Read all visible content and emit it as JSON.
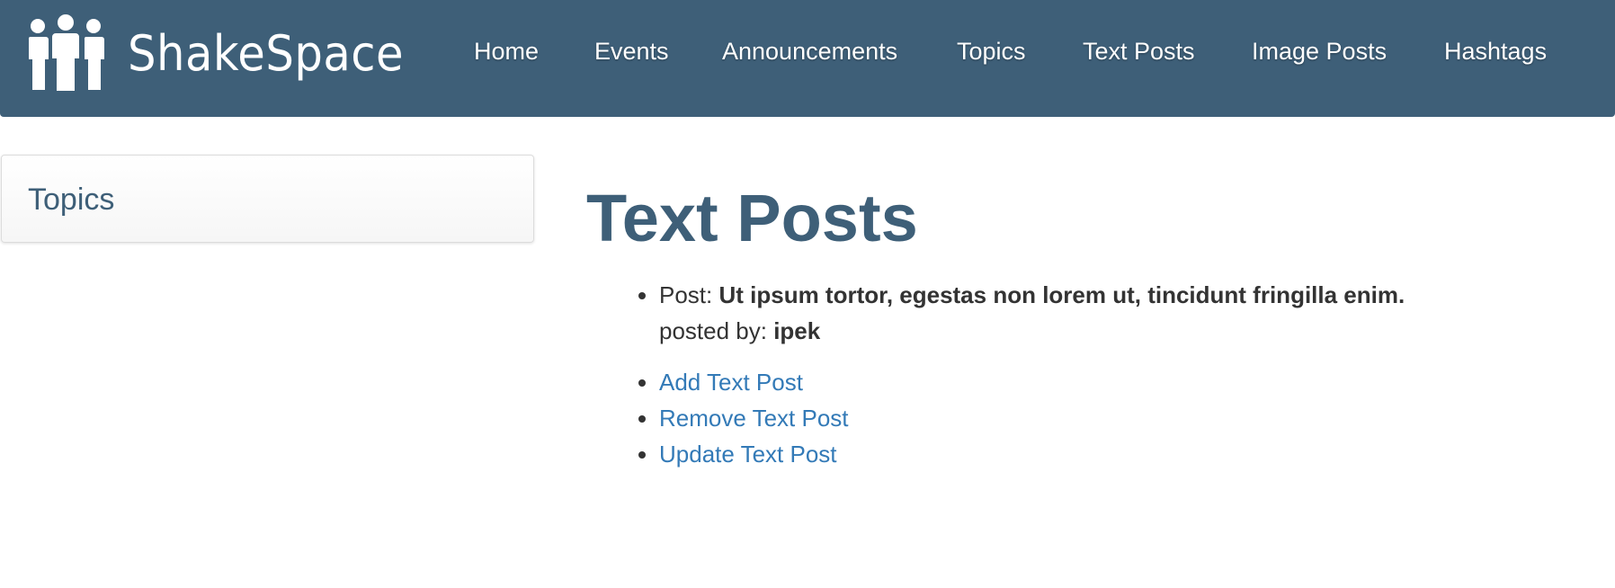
{
  "brand": {
    "name": "ShakeSpace",
    "logo_icon": "group-of-people-icon"
  },
  "nav": {
    "items": [
      {
        "label": "Home"
      },
      {
        "label": "Events"
      },
      {
        "label": "Announcements"
      },
      {
        "label": "Topics"
      },
      {
        "label": "Text Posts"
      },
      {
        "label": "Image Posts"
      },
      {
        "label": "Hashtags"
      }
    ]
  },
  "sidebar": {
    "title": "Topics"
  },
  "main": {
    "title": "Text Posts",
    "posts": [
      {
        "post_prefix": "Post: ",
        "text": "Ut ipsum tortor, egestas non lorem ut, tincidunt fringilla enim.",
        "posted_by_prefix": "posted by: ",
        "author": "ipek"
      }
    ],
    "actions": [
      {
        "label": "Add Text Post"
      },
      {
        "label": "Remove Text Post"
      },
      {
        "label": "Update Text Post"
      }
    ]
  },
  "colors": {
    "navbar": "#3e5f78",
    "link": "#337ab7",
    "heading": "#3e5f78",
    "text": "#333333"
  }
}
